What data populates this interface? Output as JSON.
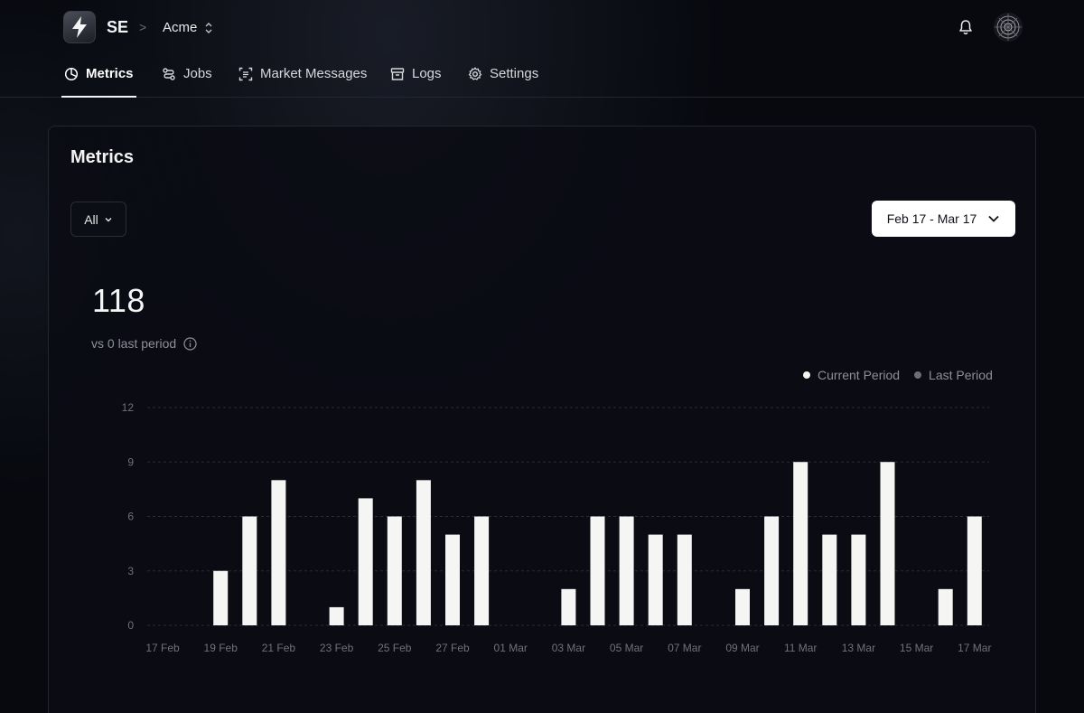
{
  "header": {
    "org": "SE",
    "separator": ">",
    "workspace": "Acme"
  },
  "tabs": [
    {
      "label": "Metrics",
      "icon": "pie-chart-icon",
      "active": true
    },
    {
      "label": "Jobs",
      "icon": "jobs-route-icon",
      "active": false
    },
    {
      "label": "Market Messages",
      "icon": "message-scan-icon",
      "active": false
    },
    {
      "label": "Logs",
      "icon": "archive-box-icon",
      "active": false
    },
    {
      "label": "Settings",
      "icon": "gear-icon",
      "active": false
    }
  ],
  "card": {
    "title": "Metrics",
    "filter_label": "All",
    "date_range": "Feb 17 - Mar 17",
    "total": "118",
    "comparison": "vs 0 last period"
  },
  "legend": {
    "current": "Current Period",
    "last": "Last Period",
    "current_color": "#f5f5f3",
    "last_color": "#6b6e76"
  },
  "chart_data": {
    "type": "bar",
    "categories": [
      "17 Feb",
      "18 Feb",
      "19 Feb",
      "20 Feb",
      "21 Feb",
      "22 Feb",
      "23 Feb",
      "24 Feb",
      "25 Feb",
      "26 Feb",
      "27 Feb",
      "28 Feb",
      "01 Mar",
      "02 Mar",
      "03 Mar",
      "04 Mar",
      "05 Mar",
      "06 Mar",
      "07 Mar",
      "08 Mar",
      "09 Mar",
      "10 Mar",
      "11 Mar",
      "12 Mar",
      "13 Mar",
      "14 Mar",
      "15 Mar",
      "16 Mar",
      "17 Mar"
    ],
    "tick_labels": [
      "17 Feb",
      "19 Feb",
      "21 Feb",
      "23 Feb",
      "25 Feb",
      "27 Feb",
      "01 Mar",
      "03 Mar",
      "05 Mar",
      "07 Mar",
      "09 Mar",
      "11 Mar",
      "13 Mar",
      "15 Mar",
      "17 Mar"
    ],
    "series": [
      {
        "name": "Current Period",
        "values": [
          0,
          0,
          3,
          6,
          8,
          0,
          1,
          7,
          6,
          8,
          5,
          6,
          0,
          0,
          2,
          6,
          6,
          5,
          5,
          0,
          2,
          6,
          9,
          5,
          5,
          9,
          0,
          2,
          6
        ]
      },
      {
        "name": "Last Period",
        "values": [
          0,
          0,
          0,
          0,
          0,
          0,
          0,
          0,
          0,
          0,
          0,
          0,
          0,
          0,
          0,
          0,
          0,
          0,
          0,
          0,
          0,
          0,
          0,
          0,
          0,
          0,
          0,
          0,
          0
        ]
      }
    ],
    "ylim": [
      0,
      12
    ],
    "yticks": [
      0,
      3,
      6,
      9,
      12
    ],
    "grid": true,
    "legend_position": "top-right"
  }
}
